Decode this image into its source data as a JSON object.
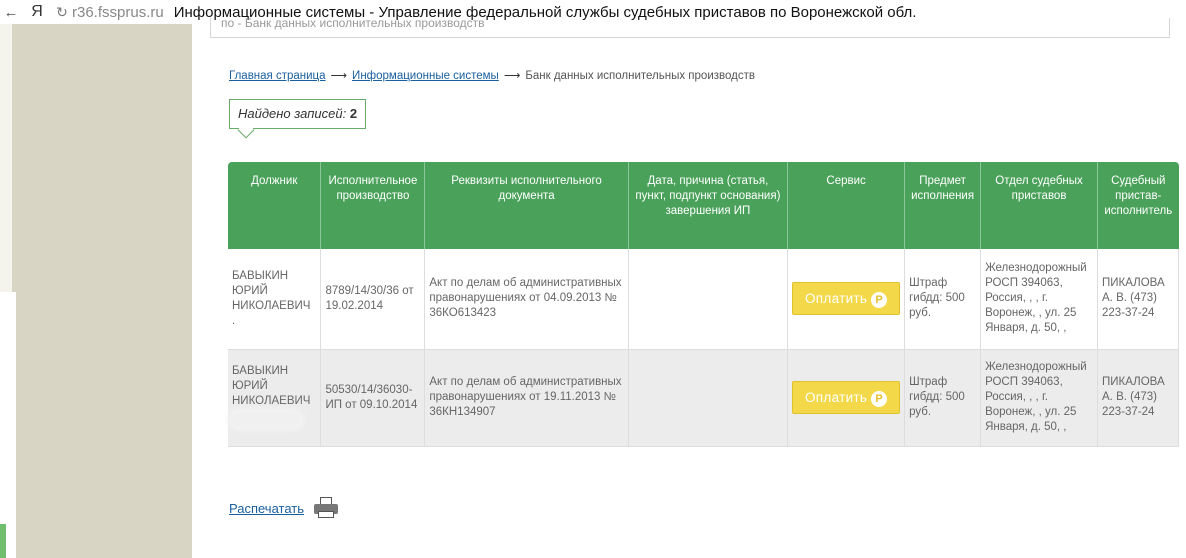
{
  "browser": {
    "back": "←",
    "yandex": "Я",
    "reload": "↻",
    "url": "r36.fssprus.ru",
    "title": "Информационные системы - Управление федеральной службы судебных приставов по Воронежской обл."
  },
  "top_box_text": "по - Банк данных исполнительных производств",
  "breadcrumb": {
    "home": "Главная страница",
    "systems": "Информационные системы",
    "current": "Банк данных исполнительных производств",
    "arrow": "⟶"
  },
  "found": {
    "label": "Найдено записей:",
    "count": "2"
  },
  "table": {
    "headers": [
      "Должник",
      "Исполнительное производство",
      "Реквизиты исполнительного документа",
      "Дата, причина (статья, пункт, подпункт основания) завершения ИП",
      "Сервис",
      "Предмет исполнения",
      "Отдел судебных приставов",
      "Судебный пристав-исполнитель"
    ],
    "rows": [
      {
        "debtor": "БАВЫКИН ЮРИЙ НИКОЛАЕВИЧ .",
        "proceeding": "8789/14/30/36 от 19.02.2014",
        "document": "Акт по делам об административных правонарушениях от 04.09.2013 № 36КО613423",
        "completion": "",
        "service": "Оплатить",
        "subject": "Штраф гибдд: 500 руб.",
        "department": "Железнодорожный РОСП 394063, Россия, , , г. Воронеж, , ул. 25 Января, д. 50, ,",
        "bailiff": "ПИКАЛОВА А. В. (473) 223-37-24"
      },
      {
        "debtor": "БАВЫКИН ЮРИЙ НИКОЛАЕВИЧ",
        "proceeding": "50530/14/36030-ИП от 09.10.2014",
        "document": "Акт по делам об административных правонарушениях от 19.11.2013 № 36КН134907",
        "completion": "",
        "service": "Оплатить",
        "subject": "Штраф гибдд: 500 руб.",
        "department": "Железнодорожный РОСП 394063, Россия, , , г. Воронеж, , ул. 25 Января, д. 50, ,",
        "bailiff": "ПИКАЛОВА А. В. (473) 223-37-24"
      }
    ]
  },
  "rub_symbol": "Р",
  "print_label": "Распечатать",
  "icons": {
    "printer": "printer-icon",
    "ruble": "ruble-icon"
  },
  "colors": {
    "header_green": "#4aa15a",
    "pay_yellow": "#f3d84a",
    "link_blue": "#1a5fa0"
  }
}
